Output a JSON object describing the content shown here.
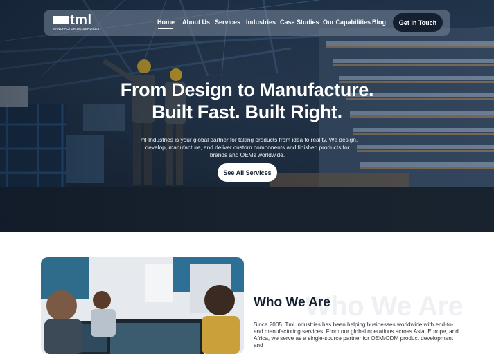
{
  "header": {
    "logo_text": "tml",
    "logo_subtitle": "MANUFACTURING SERVICES",
    "nav": [
      {
        "label": "Home",
        "active": true
      },
      {
        "label": "About Us"
      },
      {
        "label": "Services"
      },
      {
        "label": "Industries"
      },
      {
        "label": "Case Studies"
      },
      {
        "label": "Our Capabilities"
      },
      {
        "label": "Blog"
      }
    ],
    "cta_label": "Get In Touch"
  },
  "hero": {
    "title_line1": "From Design to Manufacture.",
    "title_line2": "Built Fast. Built Right.",
    "description": "Tml Industries is your global partner for taking products from idea to reality. We design, develop, manufacture, and deliver custom components and finished products for brands and OEMs worldwide.",
    "button_label": "See All Services"
  },
  "about": {
    "ghost_heading": "Who We Are",
    "heading": "Who We Are",
    "body": "Since 2005, Tml Industries has been helping businesses worldwide with end-to-end manufacturing services. From our global operations across Asia, Europe, and Africa, we serve as a single-source partner for OEM/ODM product development and"
  },
  "colors": {
    "navy": "#14202f",
    "white": "#ffffff"
  }
}
